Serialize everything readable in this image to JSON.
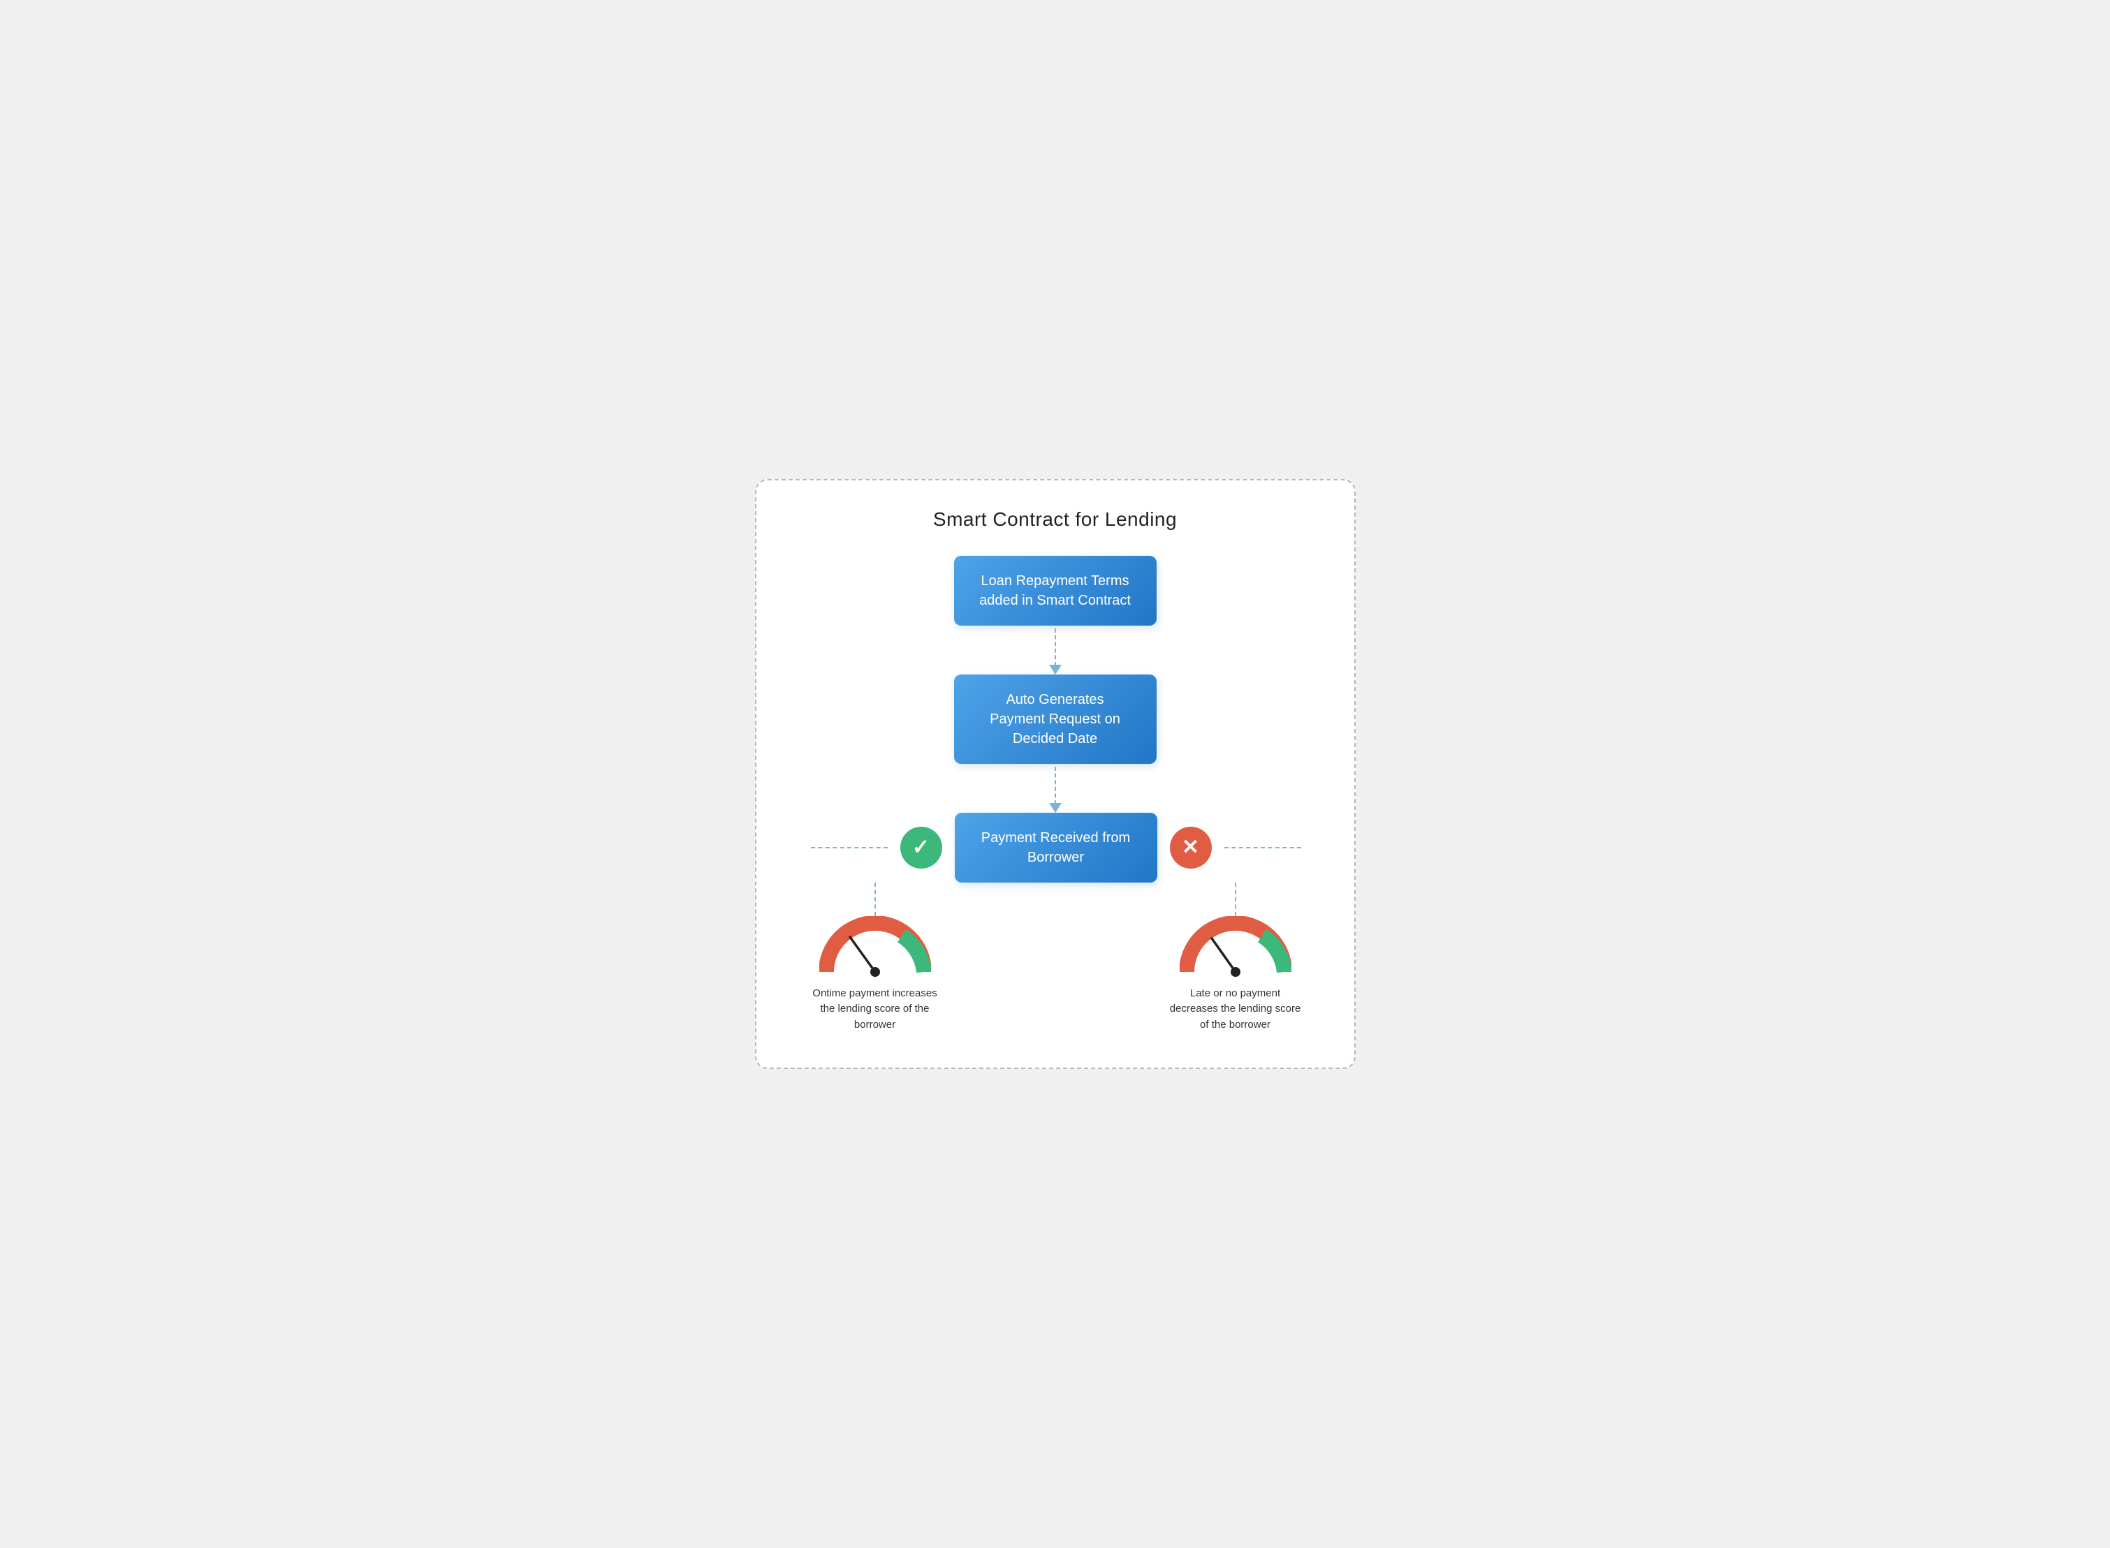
{
  "title": "Smart Contract for Lending",
  "boxes": {
    "box1": "Loan Repayment Terms added in Smart Contract",
    "box2": "Auto Generates Payment Request on Decided Date",
    "box3": "Payment Received from Borrower"
  },
  "outcomes": {
    "left": {
      "icon": "✓",
      "label": "Ontime payment increases the lending score of the borrower"
    },
    "right": {
      "icon": "✕",
      "label": "Late or no payment decreases the lending score of the borrower"
    }
  },
  "colors": {
    "boxGradientStart": "#4fa3e8",
    "boxGradientEnd": "#2176c7",
    "arrowColor": "#7ab3d9",
    "checkBg": "#3cb97a",
    "xBg": "#e05d44",
    "gaugeFill1": "#e05d44",
    "gaugeFill2": "#f0a030",
    "gaugeFill3": "#3cb97a"
  }
}
